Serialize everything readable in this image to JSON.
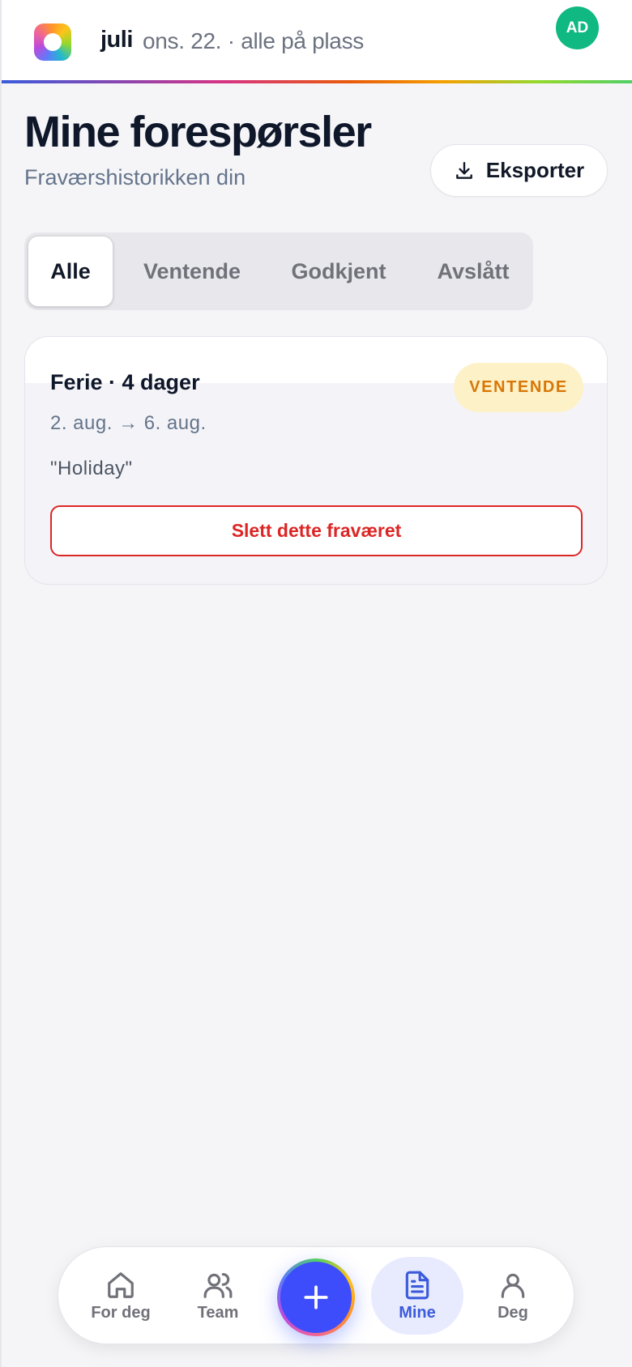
{
  "header": {
    "brand": "juli",
    "subtitle": "ons. 22. · alle på plass",
    "avatar_initials": "AD"
  },
  "page": {
    "title": "Mine forespørsler",
    "subtitle": "Fraværshistorikken din",
    "export_label": "Eksporter"
  },
  "tabs": [
    {
      "label": "Alle",
      "active": true
    },
    {
      "label": "Ventende",
      "active": false
    },
    {
      "label": "Godkjent",
      "active": false
    },
    {
      "label": "Avslått",
      "active": false
    }
  ],
  "requests": [
    {
      "title": "Ferie · 4 dager",
      "status": "VENTENDE",
      "dates": "2. aug. → 6. aug.",
      "note": "\"Holiday\"",
      "delete_label": "Slett dette fraværet"
    }
  ],
  "bottom_nav": {
    "items": [
      {
        "label": "For deg",
        "icon": "home-icon"
      },
      {
        "label": "Team",
        "icon": "users-icon"
      },
      {
        "label": "Mine",
        "icon": "document-icon",
        "active": true
      },
      {
        "label": "Deg",
        "icon": "user-icon"
      }
    ],
    "fab_icon": "plus-icon"
  },
  "colors": {
    "accent": "#3d4dfb",
    "avatar": "#10b981",
    "pending_bg": "#fdf1c8",
    "pending_text": "#d97706",
    "danger": "#dc2626"
  }
}
